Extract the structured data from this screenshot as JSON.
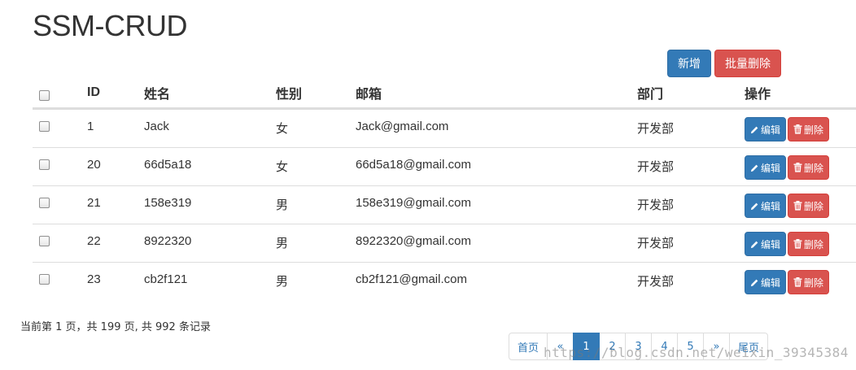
{
  "page": {
    "title": "SSM-CRUD"
  },
  "toolbar": {
    "add_label": "新增",
    "batch_delete_label": "批量删除"
  },
  "table": {
    "headers": {
      "id": "ID",
      "name": "姓名",
      "gender": "性别",
      "email": "邮箱",
      "dept": "部门",
      "ops": "操作"
    },
    "rows": [
      {
        "id": "1",
        "name": "Jack",
        "gender": "女",
        "email": "Jack@gmail.com",
        "dept": "开发部"
      },
      {
        "id": "20",
        "name": "66d5a18",
        "gender": "女",
        "email": "66d5a18@gmail.com",
        "dept": "开发部"
      },
      {
        "id": "21",
        "name": "158e319",
        "gender": "男",
        "email": "158e319@gmail.com",
        "dept": "开发部"
      },
      {
        "id": "22",
        "name": "8922320",
        "gender": "男",
        "email": "8922320@gmail.com",
        "dept": "开发部"
      },
      {
        "id": "23",
        "name": "cb2f121",
        "gender": "男",
        "email": "cb2f121@gmail.com",
        "dept": "开发部"
      }
    ],
    "edit_label": "编辑",
    "delete_label": "删除"
  },
  "footer": {
    "info": "当前第 1 页，共 199 页, 共 992 条记录"
  },
  "pagination": {
    "first": "首页",
    "prev": "«",
    "pages": [
      "1",
      "2",
      "3",
      "4",
      "5"
    ],
    "next": "»",
    "last": "尾页",
    "current": "1"
  },
  "watermark": "https://blog.csdn.net/weixin_39345384",
  "colors": {
    "primary": "#337ab7",
    "danger": "#d9534f",
    "border": "#dddddd"
  },
  "icons": {
    "edit": "pencil-icon",
    "delete": "trash-icon"
  }
}
